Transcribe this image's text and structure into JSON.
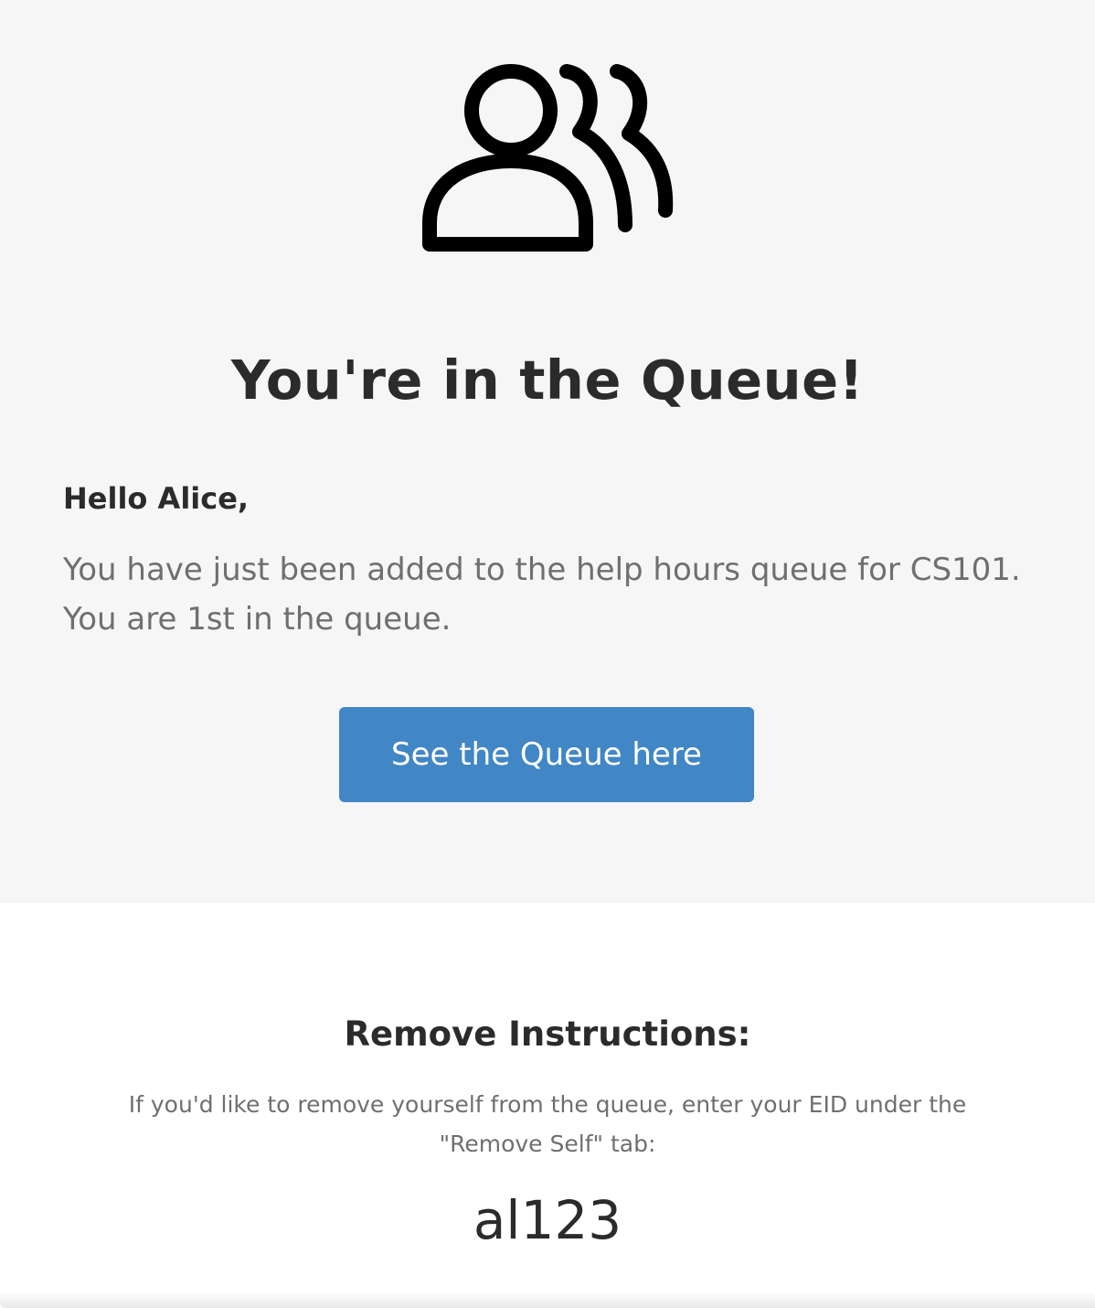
{
  "header": {
    "icon": "queue-people-icon",
    "title": "You're in the Queue!"
  },
  "message": {
    "greeting": "Hello Alice,",
    "line1": "You have just been added to the help hours queue for CS101.",
    "line2": "You are 1st in the queue."
  },
  "button": {
    "label": "See the Queue here"
  },
  "remove": {
    "title": "Remove Instructions:",
    "line1": "If you'd like to remove yourself from the queue, enter your EID under the",
    "line2": "\"Remove Self\" tab:",
    "eid": "al123"
  },
  "colors": {
    "hero_background": "#f6f6f6",
    "button": "#4186c5",
    "heading": "#2b2b2b",
    "body_text": "#6f6f6f"
  }
}
